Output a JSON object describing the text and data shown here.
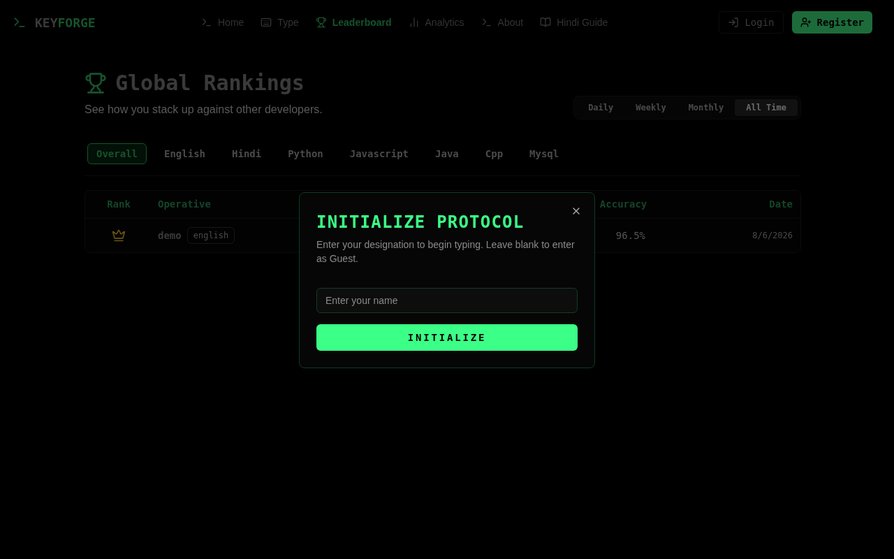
{
  "brand": {
    "part_1": "KEY",
    "part_2": "FORGE"
  },
  "nav": [
    {
      "label": "Home",
      "selected": false
    },
    {
      "label": "Type",
      "selected": false
    },
    {
      "label": "Leaderboard",
      "selected": true
    },
    {
      "label": "Analytics",
      "selected": false
    },
    {
      "label": "About",
      "selected": false
    },
    {
      "label": "Hindi Guide",
      "selected": false
    }
  ],
  "auth": {
    "login": "Login",
    "register": "Register"
  },
  "page": {
    "title": "Global Rankings",
    "subtitle": "See how you stack up against other developers."
  },
  "periods": [
    {
      "label": "Daily",
      "selected": false
    },
    {
      "label": "Weekly",
      "selected": false
    },
    {
      "label": "Monthly",
      "selected": false
    },
    {
      "label": "All Time",
      "selected": true
    }
  ],
  "categories": [
    {
      "label": "Overall",
      "selected": true
    },
    {
      "label": "English",
      "selected": false
    },
    {
      "label": "Hindi",
      "selected": false
    },
    {
      "label": "Python",
      "selected": false
    },
    {
      "label": "Javascript",
      "selected": false
    },
    {
      "label": "Java",
      "selected": false
    },
    {
      "label": "Cpp",
      "selected": false
    },
    {
      "label": "Mysql",
      "selected": false
    }
  ],
  "table": {
    "columns": [
      "Rank",
      "Operative",
      "Accuracy",
      "Date"
    ],
    "rows": [
      {
        "kind": "crown",
        "operative": "demo",
        "tag": "english",
        "accuracy": "96.5%",
        "date": "8/6/2026"
      }
    ]
  },
  "modal": {
    "title": "INITIALIZE PROTOCOL",
    "text": "Enter your designation to begin typing. Leave blank to enter as Guest.",
    "placeholder": "Enter your name",
    "button": "INITIALIZE"
  }
}
